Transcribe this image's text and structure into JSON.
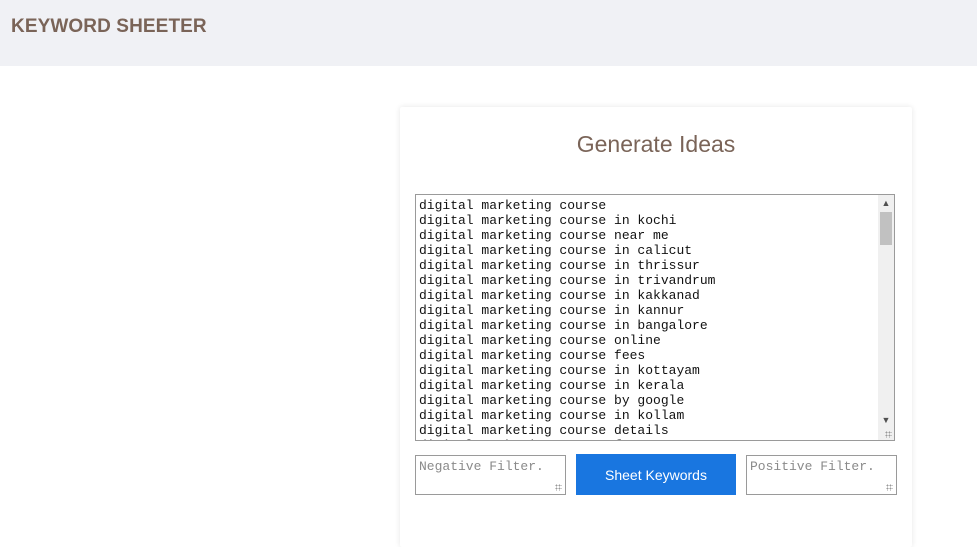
{
  "header": {
    "brand": "KEYWORD SHEETER"
  },
  "card": {
    "title": "Generate Ideas",
    "ideas": [
      "digital marketing course",
      "digital marketing course in kochi",
      "digital marketing course near me",
      "digital marketing course in calicut",
      "digital marketing course in thrissur",
      "digital marketing course in trivandrum",
      "digital marketing course in kakkanad",
      "digital marketing course in kannur",
      "digital marketing course in bangalore",
      "digital marketing course online",
      "digital marketing course fees",
      "digital marketing course in kottayam",
      "digital marketing course in kerala",
      "digital marketing course by google",
      "digital marketing course in kollam",
      "digital marketing course details",
      "digital marketing course free"
    ],
    "scroll_up_icon": "▲",
    "scroll_down_icon": "▼",
    "negative_filter_placeholder": "Negative Filter.",
    "positive_filter_placeholder": "Positive Filter.",
    "sheet_button_label": "Sheet Keywords"
  },
  "colors": {
    "brand_text": "#7a6458",
    "header_bg": "#f0f1f5",
    "button_bg": "#1976e0"
  }
}
